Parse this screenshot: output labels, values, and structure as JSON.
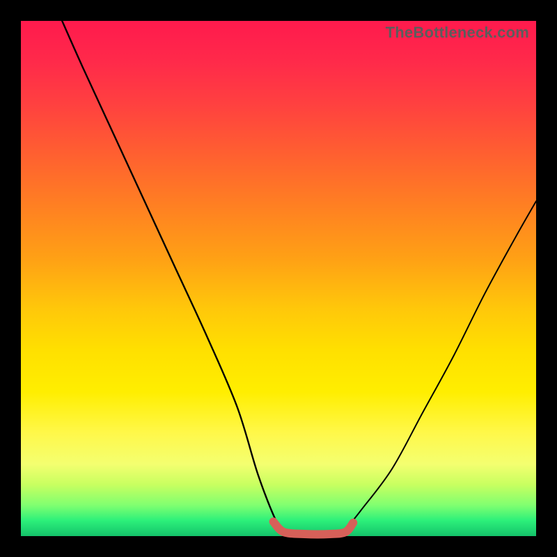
{
  "watermark": "TheBottleneck.com",
  "chart_data": {
    "type": "line",
    "title": "",
    "xlabel": "",
    "ylabel": "",
    "xlim": [
      0,
      100
    ],
    "ylim": [
      0,
      100
    ],
    "grid": false,
    "legend": false,
    "series": [
      {
        "name": "left_curve",
        "x": [
          8,
          12,
          18,
          24,
          30,
          36,
          42,
          46,
          49.5,
          51.5
        ],
        "y": [
          100,
          91,
          78,
          65,
          52,
          39,
          25,
          12,
          3,
          0
        ]
      },
      {
        "name": "right_curve",
        "x": [
          62,
          66,
          72,
          78,
          84,
          90,
          96,
          100
        ],
        "y": [
          0,
          5,
          13,
          24,
          35,
          47,
          58,
          65
        ]
      },
      {
        "name": "flat_bottom_marker",
        "x": [
          49,
          51,
          55,
          60,
          63,
          64.5
        ],
        "y": [
          2.8,
          0.8,
          0.4,
          0.4,
          0.8,
          2.6
        ]
      }
    ],
    "marker_color": "#d66059",
    "gradient_stops": [
      {
        "pos": 0,
        "color": "#ff1a4d"
      },
      {
        "pos": 50,
        "color": "#ffb010"
      },
      {
        "pos": 75,
        "color": "#fff000"
      },
      {
        "pos": 95,
        "color": "#60ff70"
      },
      {
        "pos": 100,
        "color": "#14c26a"
      }
    ]
  }
}
